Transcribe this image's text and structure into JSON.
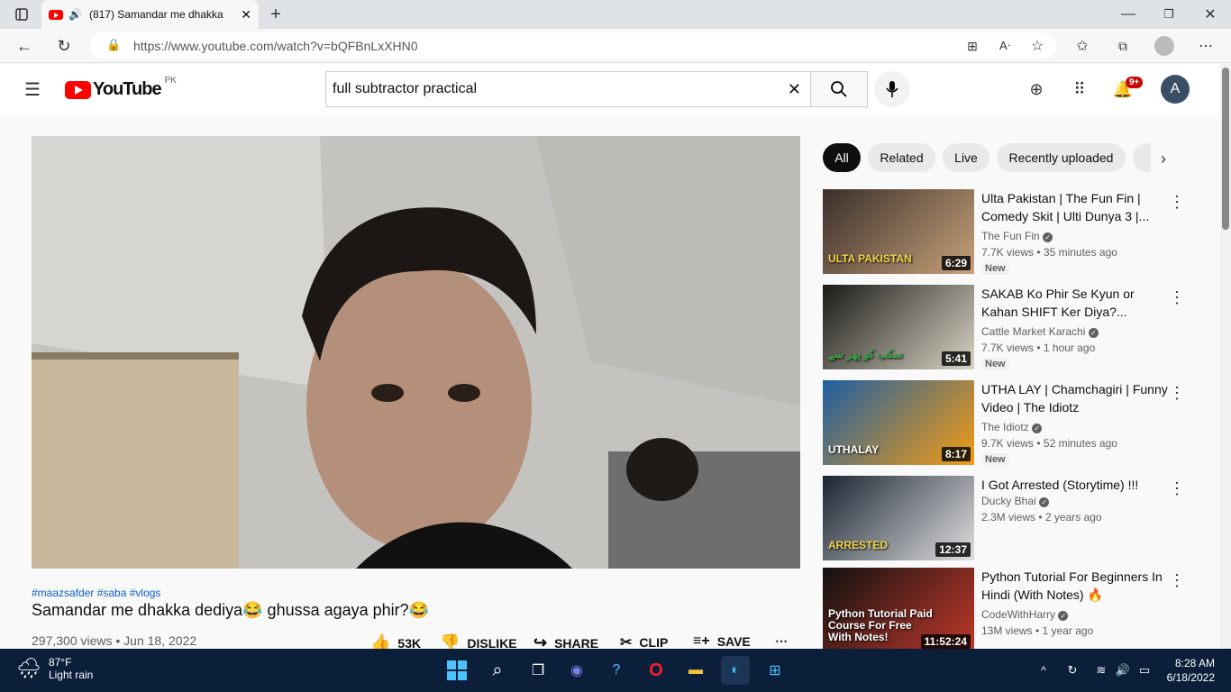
{
  "browser": {
    "tab_title": "(817) Samandar me dhakka",
    "url": "https://www.youtube.com/watch?v=bQFBnLxXHN0"
  },
  "youtube": {
    "logo_text": "YouTube",
    "region": "PK",
    "search_value": "full subtractor practical",
    "notifications": "9+",
    "avatar_letter": "A"
  },
  "video": {
    "hashtags": "#maazsafder #saba #vlogs",
    "title": "Samandar me dhakka dediya😂 ghussa agaya phir?😂",
    "views_date": "297,300 views • Jun 18, 2022",
    "likes": "53K",
    "dislike": "DISLIKE",
    "share": "SHARE",
    "clip": "CLIP",
    "save": "SAVE"
  },
  "chips": [
    "All",
    "Related",
    "Live",
    "Recently uploaded"
  ],
  "recommendations": [
    {
      "title": "Ulta Pakistan | The Fun Fin | Comedy Skit | Ulti Dunya 3 |...",
      "channel": "The Fun Fin",
      "views": "7.7K views • 35 minutes ago",
      "badge": "New",
      "duration": "6:29",
      "thumb_text": "ULTA PAKISTAN",
      "colors": [
        "#3a2f2b",
        "#c8a27a",
        "#f3d34a"
      ]
    },
    {
      "title": "SAKAB Ko Phir Se Kyun or Kahan SHIFT Ker Diya?...",
      "channel": "Cattle Market Karachi",
      "views": "7.7K views • 1 hour ago",
      "badge": "New",
      "duration": "5:41",
      "thumb_text": "سکب کو پھر سے",
      "colors": [
        "#1a1a18",
        "#d9d4c4",
        "#3aa842"
      ]
    },
    {
      "title": "UTHA LAY | Chamchagiri | Funny Video | The Idiotz",
      "channel": "The Idiotz",
      "views": "9.7K views • 52 minutes ago",
      "badge": "New",
      "duration": "8:17",
      "thumb_text": "UTHALAY",
      "colors": [
        "#1f5fa3",
        "#f39c12",
        "#ffffff"
      ]
    },
    {
      "title": "I Got Arrested (Storytime) !!!",
      "channel": "Ducky Bhai",
      "views": "2.3M views • 2 years ago",
      "badge": "",
      "duration": "12:37",
      "thumb_text": "ARRESTED",
      "colors": [
        "#1b2533",
        "#e0e0e0",
        "#f3d34a"
      ]
    },
    {
      "title": "Python Tutorial For Beginners In Hindi (With Notes) 🔥",
      "channel": "CodeWithHarry",
      "views": "13M views • 1 year ago",
      "badge": "",
      "duration": "11:52:24",
      "thumb_text": "Python Tutorial Paid Course For Free With Notes!",
      "colors": [
        "#111111",
        "#c0392b",
        "#ffffff"
      ]
    }
  ],
  "taskbar": {
    "temp": "87°F",
    "weather": "Light rain",
    "time": "8:28 AM",
    "date": "6/18/2022"
  }
}
